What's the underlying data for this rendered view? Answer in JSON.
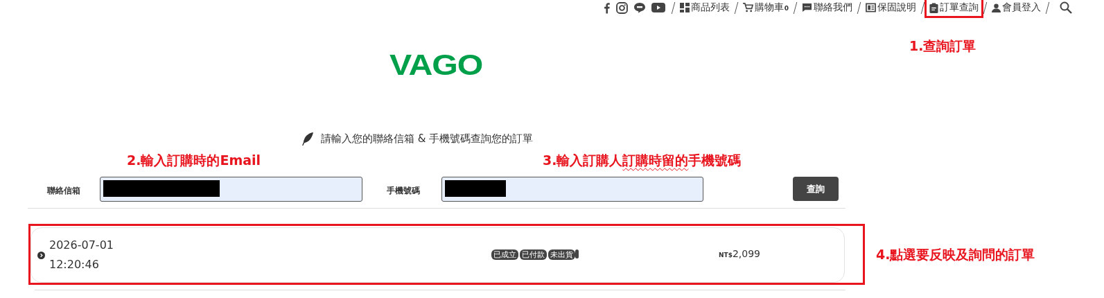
{
  "top_nav": {
    "social": [
      {
        "kind": "facebook"
      },
      {
        "kind": "instagram"
      },
      {
        "kind": "line"
      },
      {
        "kind": "youtube"
      }
    ],
    "links": [
      {
        "kind": "grid",
        "label": "商品列表",
        "highlighted": false
      },
      {
        "kind": "cart",
        "label": "購物車",
        "count": "0",
        "highlighted": false
      },
      {
        "kind": "chat",
        "label": "聯絡我們",
        "highlighted": false
      },
      {
        "kind": "book",
        "label": "保固說明",
        "highlighted": false
      },
      {
        "kind": "clipboard",
        "label": "訂單查詢",
        "highlighted": true
      },
      {
        "kind": "user",
        "label": "會員登入",
        "highlighted": false
      }
    ]
  },
  "logo": "VAGO",
  "intro": "請輸入您的聯絡信箱 & 手機號碼查詢您的訂單",
  "form": {
    "email_label": "聯絡信箱",
    "phone_label": "手機號碼",
    "button": "查詢"
  },
  "orders": [
    {
      "date": "2026-07-01",
      "time": "12:20:46",
      "badges": [
        "已成立",
        "已付款",
        "未出貨"
      ],
      "currency": "NT$",
      "amount": "2,099"
    }
  ],
  "annotations": [
    {
      "segments": [
        {
          "text": "1.查詢訂單",
          "squiggle": false
        }
      ]
    },
    {
      "segments": [
        {
          "text": "2.輸入訂購時的Email",
          "squiggle": false
        }
      ]
    },
    {
      "segments": [
        {
          "text": "3.輸入訂購人",
          "squiggle": false
        },
        {
          "text": "訂購時留的",
          "squiggle": true
        },
        {
          "text": "手機號碼",
          "squiggle": false
        }
      ]
    },
    {
      "segments": [
        {
          "text": "4.點選要反映及詢問的訂單",
          "squiggle": false
        }
      ]
    }
  ]
}
